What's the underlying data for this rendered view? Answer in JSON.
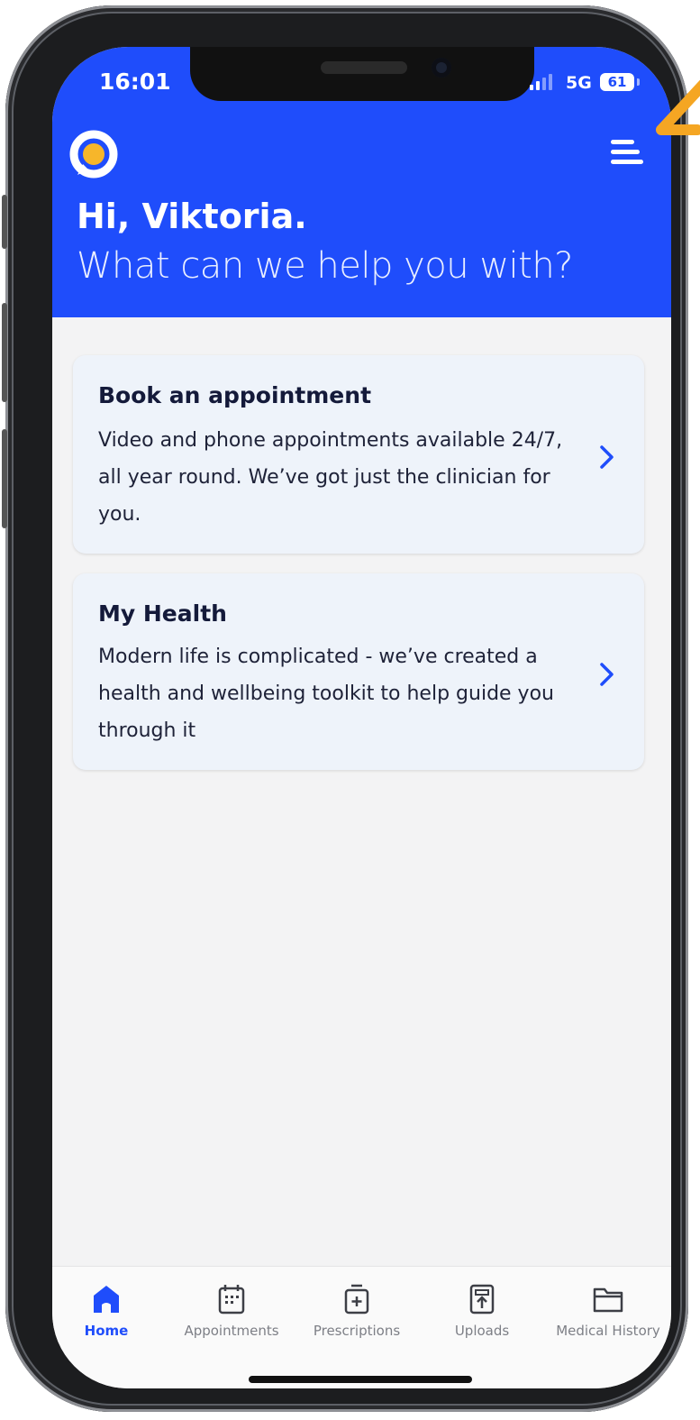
{
  "status_bar": {
    "time": "16:01",
    "network": "5G",
    "battery": "61"
  },
  "header": {
    "logo_icon": "brand-logo-icon",
    "menu_icon": "hamburger-menu-icon",
    "greeting": "Hi, Viktoria.",
    "subtitle": "What can we help you with?"
  },
  "cards": [
    {
      "title": "Book an appointment",
      "description": "Video and phone appointments available 24/7, all year round. We’ve got just the clinician for you.",
      "icon": "chevron-right-icon"
    },
    {
      "title": "My Health",
      "description": "Modern life is complicated - we’ve created a health and wellbeing toolkit to help guide you  through it",
      "icon": "chevron-right-icon"
    }
  ],
  "tabbar": {
    "tabs": [
      {
        "label": "Home",
        "icon": "home-icon",
        "active": true
      },
      {
        "label": "Appointments",
        "icon": "calendar-icon",
        "active": false
      },
      {
        "label": "Prescriptions",
        "icon": "medicine-bottle-icon",
        "active": false
      },
      {
        "label": "Uploads",
        "icon": "upload-icon",
        "active": false
      },
      {
        "label": "Medical History",
        "icon": "folder-icon",
        "active": false
      }
    ]
  },
  "colors": {
    "brand_blue": "#1f4dfb",
    "logo_yellow": "#f7b62a",
    "card_background": "#eef3fa",
    "annotation_orange": "#f5a623"
  }
}
